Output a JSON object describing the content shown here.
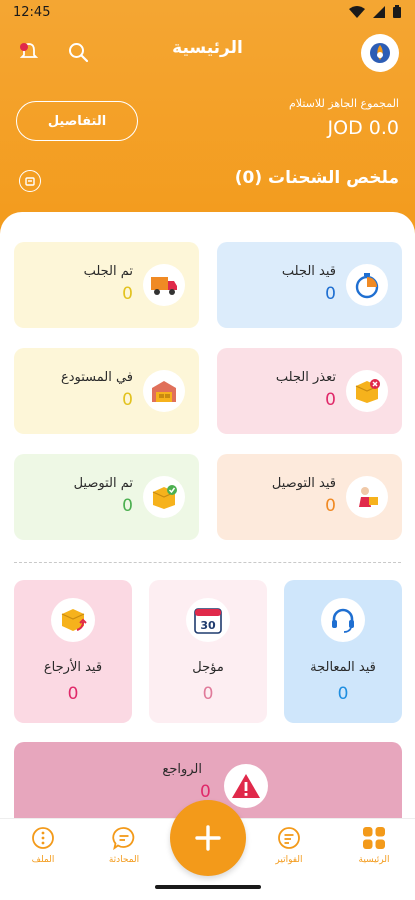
{
  "status_bar": {
    "time": "12:45"
  },
  "header": {
    "title": "الرئيسية",
    "ready_label": "المجموع الجاهز للاستلام",
    "ready_amount": "JOD 0.0",
    "details_label": "التفاصيل",
    "summary_title": "ملخص الشحنات (0)"
  },
  "status_cards": [
    {
      "label": "قيد الجلب",
      "count": "0",
      "bg": "#dcecfb",
      "color": "#1f6fd1",
      "icon": "stopwatch-icon"
    },
    {
      "label": "تم الجلب",
      "count": "0",
      "bg": "#fdf6d8",
      "color": "#e2c21f",
      "icon": "delivery-truck-icon"
    },
    {
      "label": "تعذر الجلب",
      "count": "0",
      "bg": "#fbe0e6",
      "color": "#e0296a",
      "icon": "box-cancel-icon"
    },
    {
      "label": "في المستودع",
      "count": "0",
      "bg": "#fdf6d8",
      "color": "#e2c21f",
      "icon": "warehouse-icon"
    },
    {
      "label": "قيد التوصيل",
      "count": "0",
      "bg": "#fdeadc",
      "color": "#f08a24",
      "icon": "courier-icon"
    },
    {
      "label": "تم التوصيل",
      "count": "0",
      "bg": "#eef8e5",
      "color": "#4caf50",
      "icon": "box-check-icon"
    }
  ],
  "square_cards": [
    {
      "label": "قيد المعالجة",
      "count": "0",
      "bg": "#cfe6fb",
      "color": "#1f8ee0",
      "icon": "headset-icon"
    },
    {
      "label": "مؤجل",
      "count": "0",
      "bg": "#fdeef2",
      "color": "#e07a9a",
      "icon": "calendar-icon",
      "day": "30"
    },
    {
      "label": "قيد الأرجاع",
      "count": "0",
      "bg": "#fbd9e3",
      "color": "#e0296a",
      "icon": "box-return-icon"
    }
  ],
  "returns_card": {
    "label": "الرواجع",
    "count": "0",
    "icon": "warning-icon"
  },
  "bottom_nav": {
    "home": "الرئيسية",
    "invoices": "الفواتير",
    "chat": "المحادثة",
    "profile": "الملف"
  }
}
